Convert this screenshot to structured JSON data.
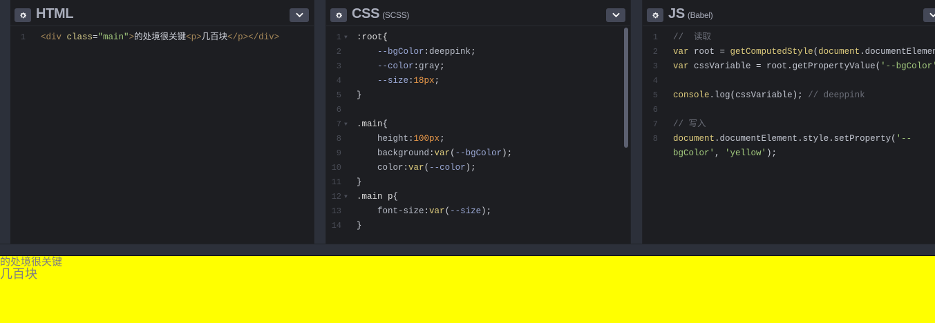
{
  "panes": {
    "html": {
      "title": "HTML",
      "subtitle": ""
    },
    "css": {
      "title": "CSS",
      "subtitle": "(SCSS)"
    },
    "js": {
      "title": "JS",
      "subtitle": "(Babel)"
    }
  },
  "icons": {
    "settings": "gear-icon",
    "menu": "chevron-down-icon"
  },
  "colors": {
    "preview_background": "#ffff00",
    "editor_background": "#1d1e22",
    "preview_text": "#808080"
  },
  "html_lines": [
    {
      "n": "1",
      "parts": [
        "<div ",
        "class",
        "=",
        "\"main\"",
        ">",
        "的处境很关键",
        "<p>",
        "几百块",
        "</p>",
        "</div>"
      ]
    }
  ],
  "css_lines": [
    {
      "n": "1",
      "fold": true,
      "parts": [
        ":root{"
      ]
    },
    {
      "n": "2",
      "parts": [
        "    ",
        "--bgColor",
        ":",
        "deeppink",
        ";"
      ]
    },
    {
      "n": "3",
      "parts": [
        "    ",
        "--color",
        ":",
        "gray",
        ";"
      ]
    },
    {
      "n": "4",
      "parts": [
        "    ",
        "--size",
        ":",
        "18px",
        ";"
      ]
    },
    {
      "n": "5",
      "parts": [
        "}"
      ]
    },
    {
      "n": "6",
      "parts": [
        ""
      ]
    },
    {
      "n": "7",
      "fold": true,
      "parts": [
        ".main",
        "{"
      ]
    },
    {
      "n": "8",
      "parts": [
        "    ",
        "height",
        ":",
        "100px",
        ";"
      ]
    },
    {
      "n": "9",
      "parts": [
        "    ",
        "background",
        ":",
        "var",
        "(",
        "--bgColor",
        ");"
      ]
    },
    {
      "n": "10",
      "parts": [
        "    ",
        "color",
        ":",
        "var",
        "(",
        "--color",
        ");"
      ]
    },
    {
      "n": "11",
      "parts": [
        "}"
      ]
    },
    {
      "n": "12",
      "fold": true,
      "parts": [
        ".main p",
        "{"
      ]
    },
    {
      "n": "13",
      "parts": [
        "    ",
        "font-size",
        ":",
        "var",
        "(",
        "--size",
        ");"
      ]
    },
    {
      "n": "14",
      "parts": [
        "}"
      ]
    }
  ],
  "js_lines": [
    {
      "n": "1",
      "parts": [
        "//  读取"
      ]
    },
    {
      "n": "2",
      "parts": [
        "var ",
        "root",
        " = ",
        "getComputedStyle",
        "(",
        "document",
        ".",
        "documentElement",
        ");"
      ]
    },
    {
      "n": "3",
      "parts": [
        "var ",
        "cssVariable",
        " = ",
        "root",
        ".",
        "getPropertyValue",
        "(",
        "'--bgColor'",
        ");"
      ]
    },
    {
      "n": "4",
      "parts": [
        ""
      ]
    },
    {
      "n": "5",
      "parts": [
        "console",
        ".",
        "log",
        "(",
        "cssVariable",
        "); ",
        "// deeppink"
      ]
    },
    {
      "n": "6",
      "parts": [
        ""
      ]
    },
    {
      "n": "7",
      "parts": [
        "// 写入"
      ]
    },
    {
      "n": "8",
      "parts": [
        "document",
        ".",
        "documentElement",
        ".",
        "style",
        ".",
        "setProperty",
        "(",
        "'--"
      ]
    },
    {
      "n": "",
      "parts": [
        "bgColor'",
        ", ",
        "'yellow'",
        ");"
      ]
    }
  ],
  "preview": {
    "main_text": "的处境很关键",
    "p_text": "几百块"
  }
}
